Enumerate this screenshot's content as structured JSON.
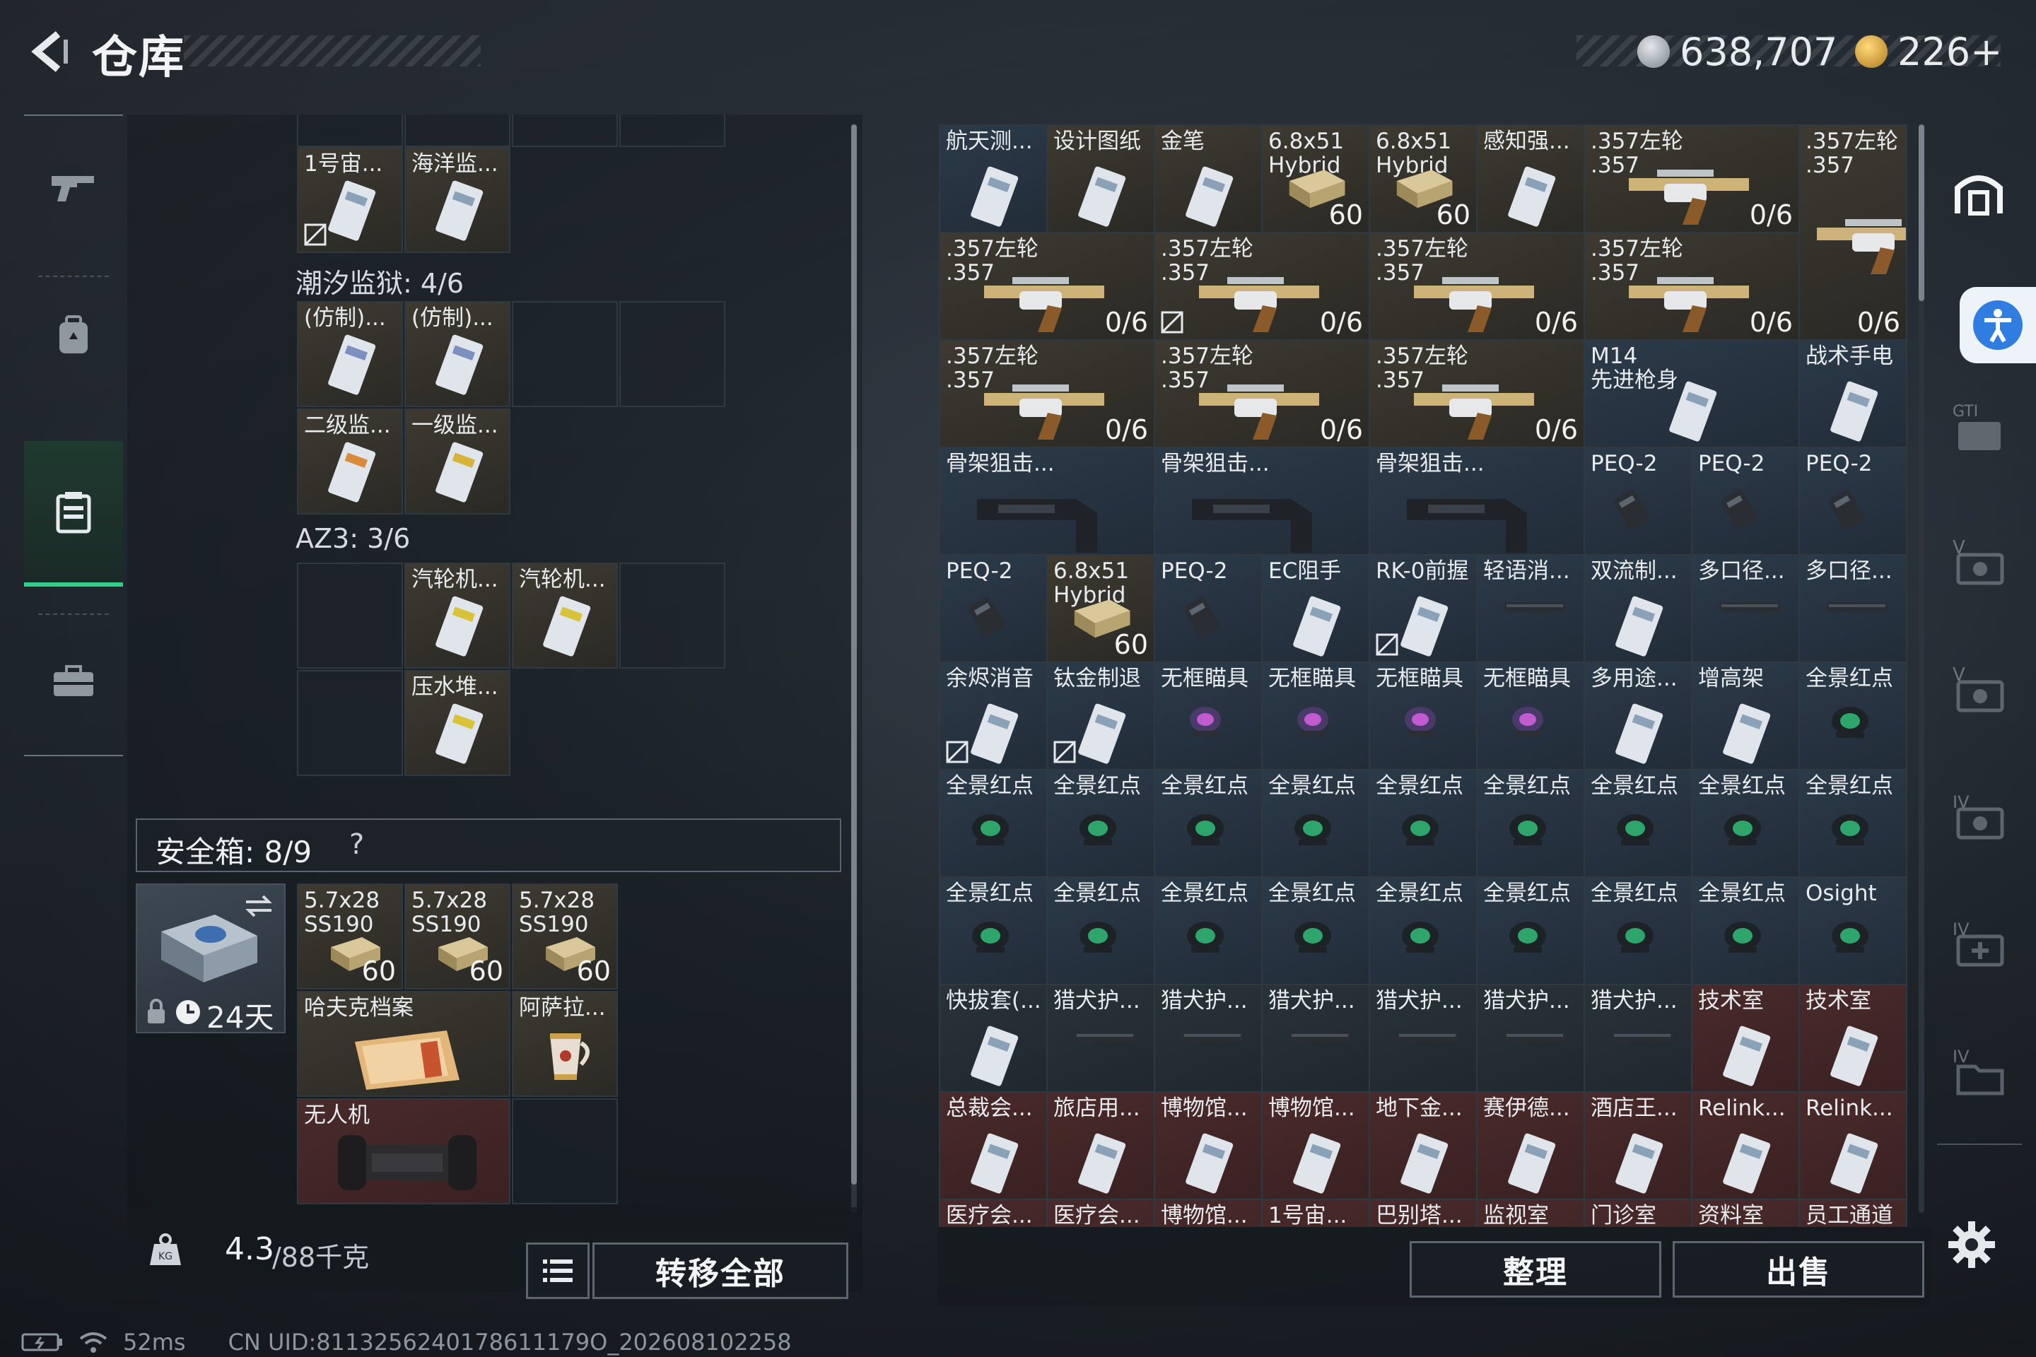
{
  "header": {
    "title": "仓库",
    "currency_coins": "638,707",
    "currency_premium": "226+"
  },
  "left_nav": [
    "gun-icon",
    "backpack-icon",
    "chest-rig-icon",
    "case-icon"
  ],
  "left_storage": {
    "row0_items": [
      {
        "name": "1号宙..."
      },
      {
        "name": "海洋监..."
      }
    ],
    "section1": {
      "label": "潮汐监狱: 4/6"
    },
    "section1_items": [
      "(仿制)...",
      "(仿制)...",
      "二级监...",
      "一级监..."
    ],
    "section2": {
      "label": "AZ3: 3/6"
    },
    "section2_items": [
      "汽轮机...",
      "汽轮机...",
      "压水堆..."
    ]
  },
  "safe_box": {
    "label": "安全箱: 8/9",
    "help": "?",
    "days": "24天",
    "items": [
      {
        "name": "5.7x28",
        "sub": "SS190",
        "count": "60"
      },
      {
        "name": "5.7x28",
        "sub": "SS190",
        "count": "60"
      },
      {
        "name": "5.7x28",
        "sub": "SS190",
        "count": "60"
      },
      {
        "name": "哈夫克档案"
      },
      {
        "name": "阿萨拉..."
      },
      {
        "name": "无人机"
      }
    ]
  },
  "bottom_left": {
    "weight": "4.3",
    "weight_max": "/88千克",
    "transfer_label": "转移全部"
  },
  "stash_rows": [
    [
      {
        "n": "航天测...",
        "c": "",
        "t": "blue"
      },
      {
        "n": "设计图纸",
        "c": "",
        "t": "gold"
      },
      {
        "n": "金笔",
        "c": "",
        "t": "gold"
      },
      {
        "n": "6.8x51",
        "n2": "Hybrid",
        "c": "60",
        "t": "gold"
      },
      {
        "n": "6.8x51",
        "n2": "Hybrid",
        "c": "60",
        "t": "gold"
      },
      {
        "n": "感知强...",
        "c": "",
        "t": "gold"
      },
      {
        "n": ".357左轮",
        "n2": ".357",
        "c": "0/6",
        "t": "gold",
        "w": 2
      },
      {
        "n": ".357左轮",
        "n2": ".357",
        "c": "0/6",
        "t": "gold",
        "h": 2
      }
    ],
    [
      {
        "n": ".357左轮",
        "n2": ".357",
        "c": "0/6",
        "t": "gold",
        "w": 2
      },
      {
        "n": ".357左轮",
        "n2": ".357",
        "c": "0/6",
        "t": "gold",
        "w": 2,
        "lock": true
      },
      {
        "n": ".357左轮",
        "n2": ".357",
        "c": "0/6",
        "t": "gold",
        "w": 2
      },
      {
        "n": ".357左轮",
        "n2": ".357",
        "c": "0/6",
        "t": "gold",
        "w": 2
      }
    ],
    [
      {
        "n": ".357左轮",
        "n2": ".357",
        "c": "0/6",
        "t": "gold",
        "w": 2
      },
      {
        "n": ".357左轮",
        "n2": ".357",
        "c": "0/6",
        "t": "gold",
        "w": 2
      },
      {
        "n": ".357左轮",
        "n2": ".357",
        "c": "0/6",
        "t": "gold",
        "w": 2
      },
      {
        "n": "M14",
        "n2": "先进枪身",
        "c": "",
        "t": "blue",
        "w": 2
      },
      {
        "n": "战术手电",
        "c": "",
        "t": "blue"
      }
    ],
    [
      {
        "n": "骨架狙击...",
        "c": "",
        "t": "blue",
        "w": 2
      },
      {
        "n": "骨架狙击...",
        "c": "",
        "t": "blue",
        "w": 2
      },
      {
        "n": "骨架狙击...",
        "c": "",
        "t": "blue",
        "w": 2
      },
      {
        "n": "PEQ-2",
        "c": "",
        "t": "blue"
      },
      {
        "n": "PEQ-2",
        "c": "",
        "t": "blue"
      },
      {
        "n": "PEQ-2",
        "c": "",
        "t": "blue"
      }
    ],
    [
      {
        "n": "PEQ-2",
        "c": "",
        "t": "blue"
      },
      {
        "n": "6.8x51",
        "n2": "Hybrid",
        "c": "60",
        "t": "gold"
      },
      {
        "n": "PEQ-2",
        "c": "",
        "t": "blue"
      },
      {
        "n": "EC阻手",
        "c": "",
        "t": "blue"
      },
      {
        "n": "RK-0前握",
        "c": "",
        "t": "blue",
        "lock": true
      },
      {
        "n": "轻语消...",
        "c": "",
        "t": "blue"
      },
      {
        "n": "双流制...",
        "c": "",
        "t": "blue"
      },
      {
        "n": "多口径...",
        "c": "",
        "t": "blue"
      },
      {
        "n": "多口径...",
        "c": "",
        "t": "blue"
      }
    ],
    [
      {
        "n": "余烬消音",
        "c": "",
        "t": "blue",
        "lock": true
      },
      {
        "n": "钛金制退",
        "c": "",
        "t": "blue",
        "lock": true
      },
      {
        "n": "无框瞄具",
        "c": "",
        "t": "blue"
      },
      {
        "n": "无框瞄具",
        "c": "",
        "t": "blue"
      },
      {
        "n": "无框瞄具",
        "c": "",
        "t": "blue"
      },
      {
        "n": "无框瞄具",
        "c": "",
        "t": "blue"
      },
      {
        "n": "多用途...",
        "c": "",
        "t": "blue"
      },
      {
        "n": "增高架",
        "c": "",
        "t": "blue"
      },
      {
        "n": "全景红点",
        "c": "",
        "t": "blue"
      }
    ],
    [
      {
        "n": "全景红点",
        "c": "",
        "t": "blue"
      },
      {
        "n": "全景红点",
        "c": "",
        "t": "blue"
      },
      {
        "n": "全景红点",
        "c": "",
        "t": "blue"
      },
      {
        "n": "全景红点",
        "c": "",
        "t": "blue"
      },
      {
        "n": "全景红点",
        "c": "",
        "t": "blue"
      },
      {
        "n": "全景红点",
        "c": "",
        "t": "blue"
      },
      {
        "n": "全景红点",
        "c": "",
        "t": "blue"
      },
      {
        "n": "全景红点",
        "c": "",
        "t": "blue"
      },
      {
        "n": "全景红点",
        "c": "",
        "t": "blue"
      }
    ],
    [
      {
        "n": "全景红点",
        "c": "",
        "t": "blue"
      },
      {
        "n": "全景红点",
        "c": "",
        "t": "blue"
      },
      {
        "n": "全景红点",
        "c": "",
        "t": "blue"
      },
      {
        "n": "全景红点",
        "c": "",
        "t": "blue"
      },
      {
        "n": "全景红点",
        "c": "",
        "t": "blue"
      },
      {
        "n": "全景红点",
        "c": "",
        "t": "blue"
      },
      {
        "n": "全景红点",
        "c": "",
        "t": "blue"
      },
      {
        "n": "全景红点",
        "c": "",
        "t": "blue"
      },
      {
        "n": "Osight",
        "c": "",
        "t": "blue"
      }
    ],
    [
      {
        "n": "快拔套(...",
        "c": "",
        "t": "green"
      },
      {
        "n": "猎犬护...",
        "c": "",
        "t": "green"
      },
      {
        "n": "猎犬护...",
        "c": "",
        "t": "green"
      },
      {
        "n": "猎犬护...",
        "c": "",
        "t": "green"
      },
      {
        "n": "猎犬护...",
        "c": "",
        "t": "green"
      },
      {
        "n": "猎犬护...",
        "c": "",
        "t": "green"
      },
      {
        "n": "猎犬护...",
        "c": "",
        "t": "green"
      },
      {
        "n": "技术室",
        "c": "",
        "t": "red"
      },
      {
        "n": "技术室",
        "c": "",
        "t": "red"
      }
    ],
    [
      {
        "n": "总裁会...",
        "c": "",
        "t": "red"
      },
      {
        "n": "旅店用...",
        "c": "",
        "t": "red"
      },
      {
        "n": "博物馆...",
        "c": "",
        "t": "red"
      },
      {
        "n": "博物馆...",
        "c": "",
        "t": "red"
      },
      {
        "n": "地下金...",
        "c": "",
        "t": "red"
      },
      {
        "n": "赛伊德...",
        "c": "",
        "t": "red"
      },
      {
        "n": "酒店王...",
        "c": "",
        "t": "red"
      },
      {
        "n": "Relink...",
        "c": "",
        "t": "red"
      },
      {
        "n": "Relink...",
        "c": "",
        "t": "red"
      }
    ],
    [
      {
        "n": "医疗会...",
        "c": "",
        "t": "red"
      },
      {
        "n": "医疗会...",
        "c": "",
        "t": "red"
      },
      {
        "n": "博物馆...",
        "c": "",
        "t": "red"
      },
      {
        "n": "1号宙...",
        "c": "",
        "t": "red"
      },
      {
        "n": "巴别塔...",
        "c": "",
        "t": "red"
      },
      {
        "n": "监视室",
        "c": "",
        "t": "red"
      },
      {
        "n": "门诊室",
        "c": "",
        "t": "red"
      },
      {
        "n": "资料室",
        "c": "",
        "t": "red"
      },
      {
        "n": "员工通道",
        "c": "",
        "t": "red"
      }
    ]
  ],
  "bottom_right": {
    "sort_label": "整理",
    "sell_label": "出售"
  },
  "right_tabs": [
    "stash-icon",
    "GTI",
    "GTI",
    "V",
    "V",
    "IV",
    "IV+",
    "IV"
  ],
  "status_bar": {
    "ping": "52ms",
    "uid": "CN UID:8113256240178611179O_202608102258"
  }
}
